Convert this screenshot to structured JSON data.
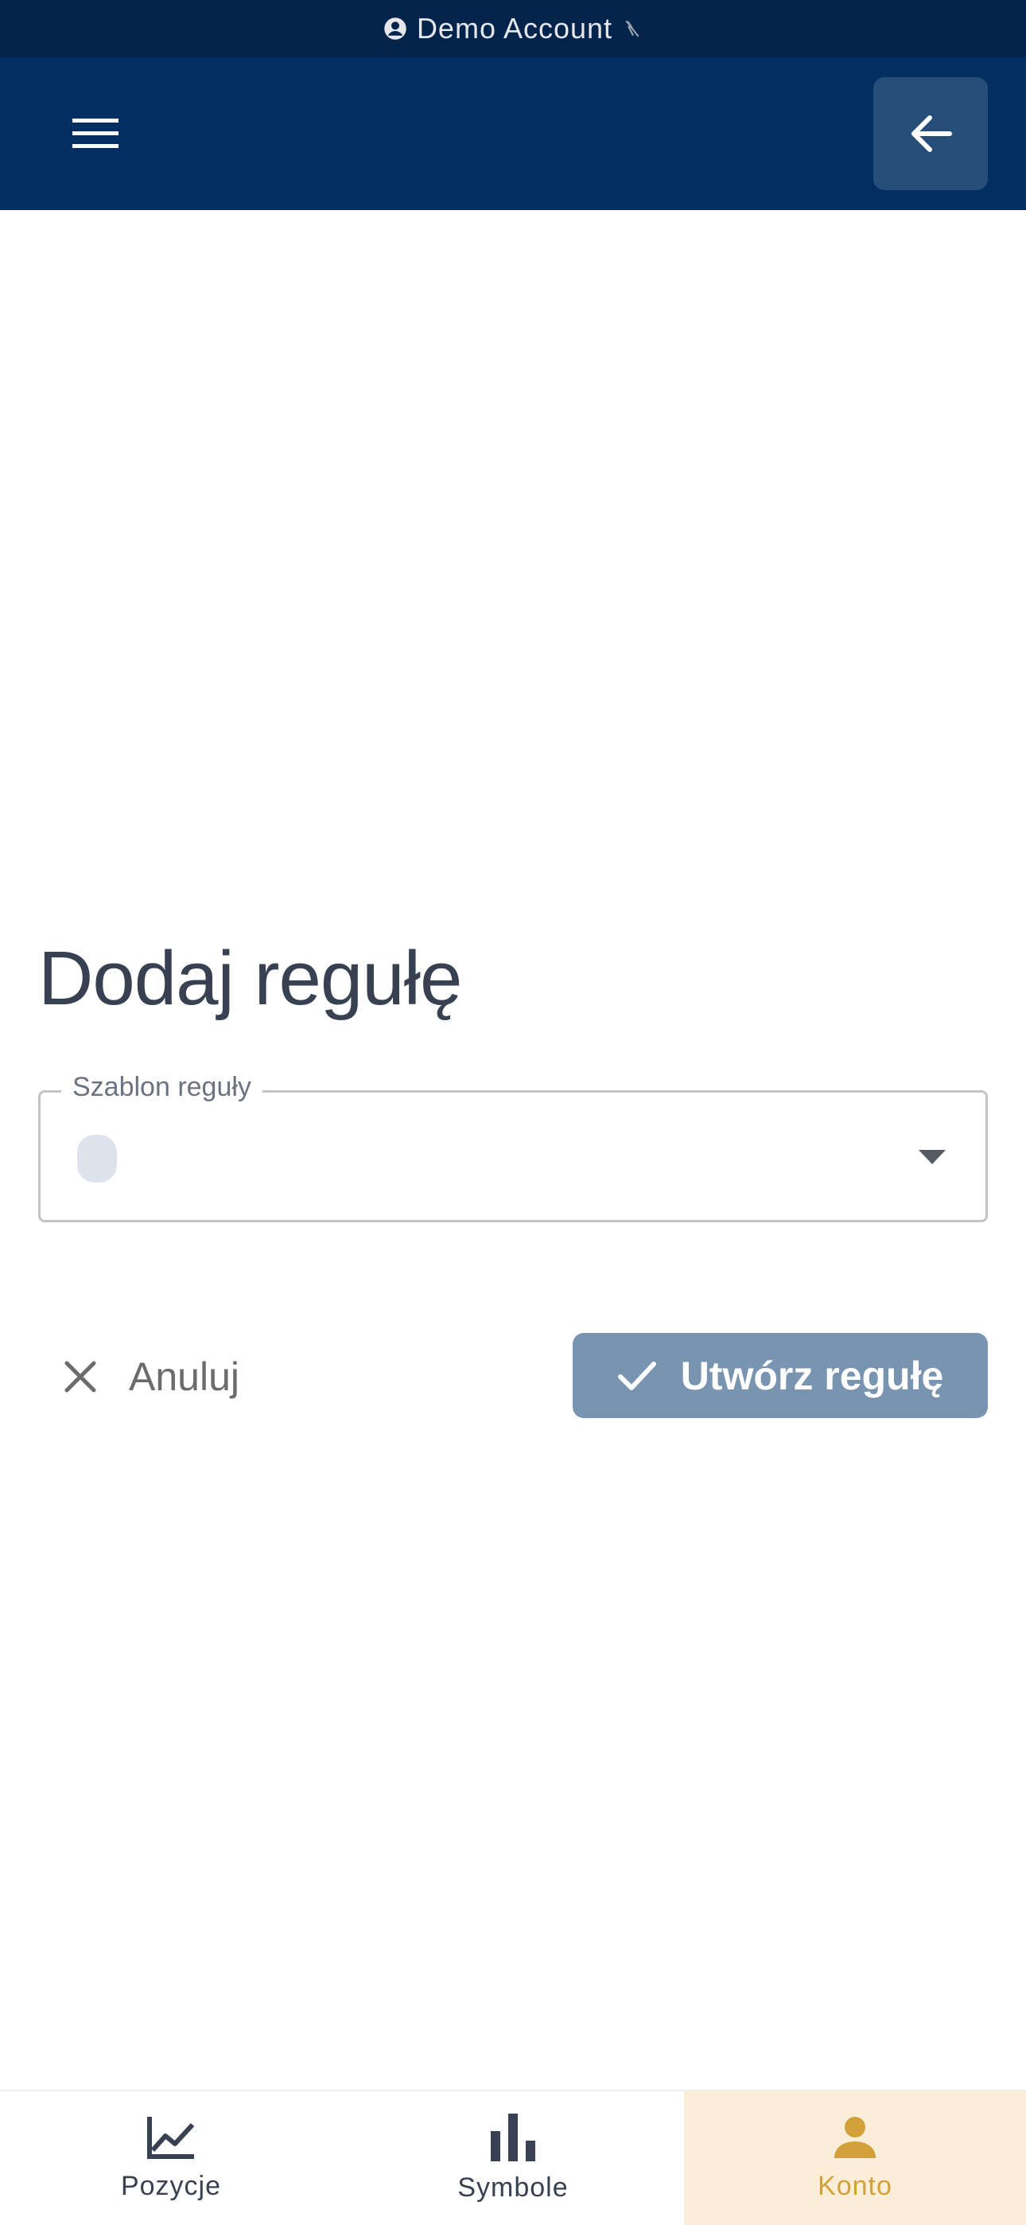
{
  "status_bar": {
    "account_label": "Demo Account"
  },
  "page": {
    "title": "Dodaj regułę"
  },
  "template_field": {
    "label": "Szablon reguły"
  },
  "actions": {
    "cancel_label": "Anuluj",
    "create_label": "Utwórz regułę"
  },
  "bottom_nav": {
    "items": [
      {
        "label": "Pozycje",
        "icon": "line-chart-icon",
        "active": false
      },
      {
        "label": "Symbole",
        "icon": "bar-chart-icon",
        "active": false
      },
      {
        "label": "Konto",
        "icon": "person-icon",
        "active": true
      }
    ]
  },
  "colors": {
    "header_bg": "#022f62",
    "status_bg": "#02234a",
    "accent": "#d4a03a",
    "create_button_disabled": "#7894b0"
  }
}
